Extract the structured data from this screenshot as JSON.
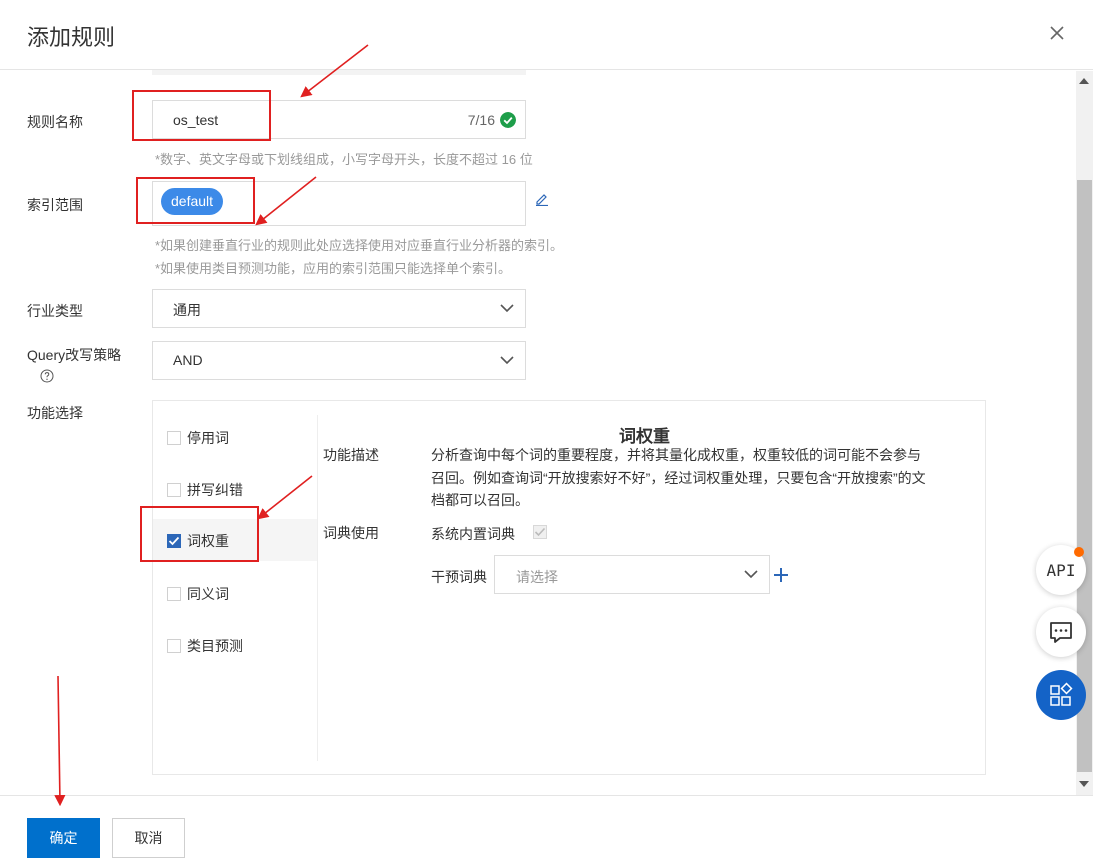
{
  "dialog": {
    "title": "添加规则"
  },
  "rule_name": {
    "label": "规则名称",
    "value": "os_test",
    "count": "7/16",
    "hint": "*数字、英文字母或下划线组成，小写字母开头，长度不超过 16 位"
  },
  "index_scope": {
    "label": "索引范围",
    "tag": "default",
    "hints": [
      "*如果创建垂直行业的规则此处应选择使用对应垂直行业分析器的索引。",
      "*如果使用类目预测功能，应用的索引范围只能选择单个索引。"
    ]
  },
  "industry": {
    "label": "行业类型",
    "value": "通用"
  },
  "query_strategy": {
    "label": "Query改写策略",
    "value": "AND"
  },
  "features": {
    "label": "功能选择",
    "items": [
      {
        "label": "停用词",
        "checked": false
      },
      {
        "label": "拼写纠错",
        "checked": false
      },
      {
        "label": "词权重",
        "checked": true
      },
      {
        "label": "同义词",
        "checked": false
      },
      {
        "label": "类目预测",
        "checked": false
      }
    ],
    "detail": {
      "title": "词权重",
      "desc_label": "功能描述",
      "desc_lines": [
        "分析查询中每个词的重要程度，并将其量化成权重，权重较低的词可能不会参与",
        "召回。例如查询词“开放搜索好不好”，经过词权重处理，只要包含“开放搜索”的文",
        "档都可以召回。"
      ],
      "dict_label": "词典使用",
      "system_dict_label": "系统内置词典",
      "intervene_label": "干预词典",
      "intervene_placeholder": "请选择"
    }
  },
  "footer": {
    "confirm": "确定",
    "cancel": "取消"
  },
  "floating": {
    "api_label": "API"
  },
  "colors": {
    "primary": "#0070cc",
    "tag": "#3c8ae8",
    "checkbox": "#2c67b8",
    "success": "#1e9e4a",
    "annotation": "#e02020",
    "notify": "#ff6a00"
  }
}
